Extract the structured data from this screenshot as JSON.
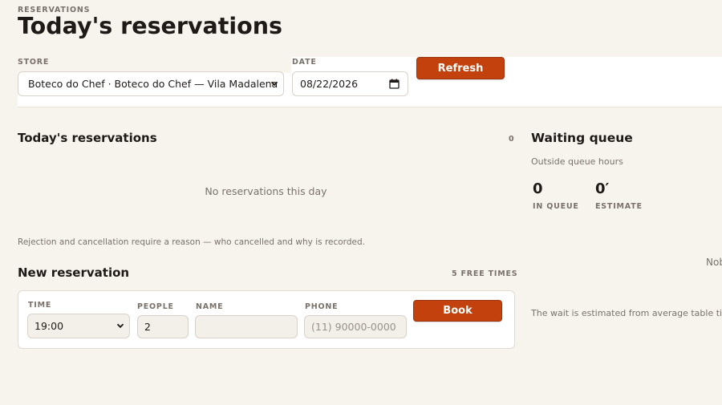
{
  "header": {
    "eyebrow": "RESERVATIONS",
    "title": "Today's reservations"
  },
  "filters": {
    "store_label": "STORE",
    "store_value": "Boteco do Chef · Boteco do Chef — Vila Madalena",
    "date_label": "DATE",
    "date_value": "08/22/2026",
    "refresh_label": "Refresh"
  },
  "reservations": {
    "title": "Today's reservations",
    "count": "0",
    "empty_text": "No reservations this day",
    "note": "Rejection and cancellation require a reason — who cancelled and why is recorded."
  },
  "new_reservation": {
    "title": "New reservation",
    "free_times": "5 FREE TIMES",
    "time_label": "TIME",
    "time_value": "19:00",
    "people_label": "PEOPLE",
    "people_value": "2",
    "name_label": "NAME",
    "name_value": "",
    "phone_label": "PHONE",
    "phone_placeholder": "(11) 90000-0000",
    "book_label": "Book"
  },
  "waiting_queue": {
    "title": "Waiting queue",
    "status": "Outside queue hours",
    "in_queue_value": "0",
    "in_queue_label": "IN QUEUE",
    "estimate_value": "0′",
    "estimate_label": "ESTIMATE",
    "truncated_text": "Nob",
    "footnote": "The wait is estimated from average table time"
  },
  "colors": {
    "accent": "#c2410c",
    "background": "#f7f4ee"
  }
}
